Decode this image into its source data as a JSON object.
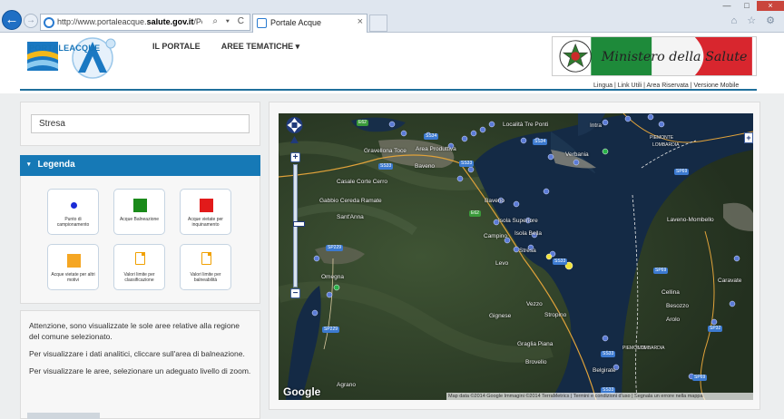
{
  "browser": {
    "url_prefix": "http://www.portaleacque.",
    "url_domain": "salute.gov.it",
    "url_suffix": "/PortaleAcqueP",
    "url_tools": "⌕ ▾ C",
    "tab_title": "Portale Acque",
    "tab_close": "×",
    "back_glyph": "←",
    "forward_glyph": "→",
    "window_controls": [
      "—",
      "□",
      "×"
    ],
    "toolbar_icons": "⌂ ☆ ⚙"
  },
  "site": {
    "logo_text": "PORTALEACQUE",
    "nav": [
      "IL PORTALE",
      "AREE TEMATICHE ▾"
    ],
    "ministry_label": "Ministero della Salute",
    "util_links": "Lingua | Link Utili | Area Riservata | Versione Mobile"
  },
  "search": {
    "value": "Stresa"
  },
  "legend": {
    "title": "Legenda",
    "caret": "▾",
    "items": [
      {
        "label": "Punto di campionamento",
        "symbol": "dot",
        "color": "#1a2bd6"
      },
      {
        "label": "Acque Balneazione",
        "symbol": "square",
        "color": "#1a8a1a"
      },
      {
        "label": "Acque vietate per inquinamento",
        "symbol": "square",
        "color": "#e21a1a"
      },
      {
        "label": "Acque vietate per altri motivi",
        "symbol": "square",
        "color": "#f5a623"
      },
      {
        "label": "Valori limite per classificazione",
        "symbol": "document",
        "color": "#f0a000"
      },
      {
        "label": "Valori limite per balneabilità",
        "symbol": "document",
        "color": "#f0a000"
      }
    ]
  },
  "info": {
    "paragraphs": [
      "Attenzione, sono visualizzate le sole aree relative alla regione del comune selezionato.",
      "Per visualizzare i dati analitici, cliccare sull'area di balneazione.",
      "Per visualizzare le aree, selezionare un adeguato livello di zoom."
    ]
  },
  "map": {
    "google_logo": "Google",
    "attribution": "Map data ©2014 Google Immagini ©2014 TerraMetrics | Termini e condizioni d'uso | Segnala un errore nella mappa",
    "zoom_in": "+",
    "zoom_out": "−",
    "pan_glyph": "✥",
    "towns": [
      "Località Tre Ponti",
      "Intra",
      "Verbania",
      "PIEMONTE",
      "LOMBARDIA",
      "Gravellona Toce",
      "Area Produttiva",
      "Baveno",
      "Casale Corte Cerro",
      "Gabbio Cereda Ramate",
      "Sant'Anna",
      "Omegna",
      "Baveno",
      "Isola Superiore",
      "Isola Bella",
      "Campino",
      "Stresa",
      "Levo",
      "Vezzo",
      "Stropino",
      "Gignese",
      "Graglia Piana",
      "Brovello",
      "Agrano",
      "Belgirate",
      "Laveno-Mombello",
      "Caravate",
      "Cellina",
      "Besozzo",
      "Arolo",
      "PIEMONTE",
      "LOMBARDIA"
    ],
    "roads": [
      "SS34",
      "SS34",
      "SS33",
      "E62",
      "SS33",
      "E62",
      "SP229",
      "SP229",
      "SS33",
      "SS33",
      "SP69",
      "SP69",
      "SP32",
      "SP69",
      "SS33"
    ]
  }
}
